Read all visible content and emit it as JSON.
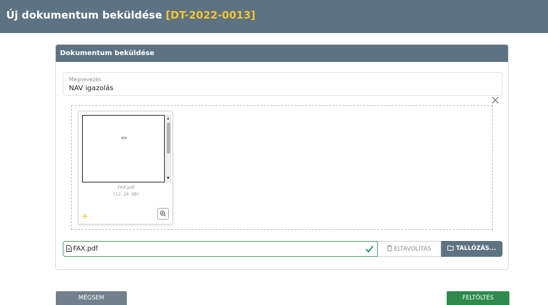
{
  "header": {
    "title": "Új dokumentum beküldése",
    "code": "[DT-2022-0013]"
  },
  "panel": {
    "heading": "Dokumentum beküldése"
  },
  "name_field": {
    "label": "Megnevezés",
    "value": "NAV igazolás"
  },
  "file_card": {
    "preview_text": "NAV",
    "file_name": "FAX.pdf",
    "file_size": "(12.28 KB)"
  },
  "file_input": {
    "value": "FAX.pdf",
    "remove_label": "ELTÁVOLÍTÁS",
    "browse_label": "TALLÓZÁS..."
  },
  "footer": {
    "cancel_label": "MÉGSEM",
    "upload_label": "FELTÖLTÉS"
  },
  "colors": {
    "header_bg": "#5d7383",
    "code_accent": "#f7c531",
    "success": "#2d8a4c"
  }
}
